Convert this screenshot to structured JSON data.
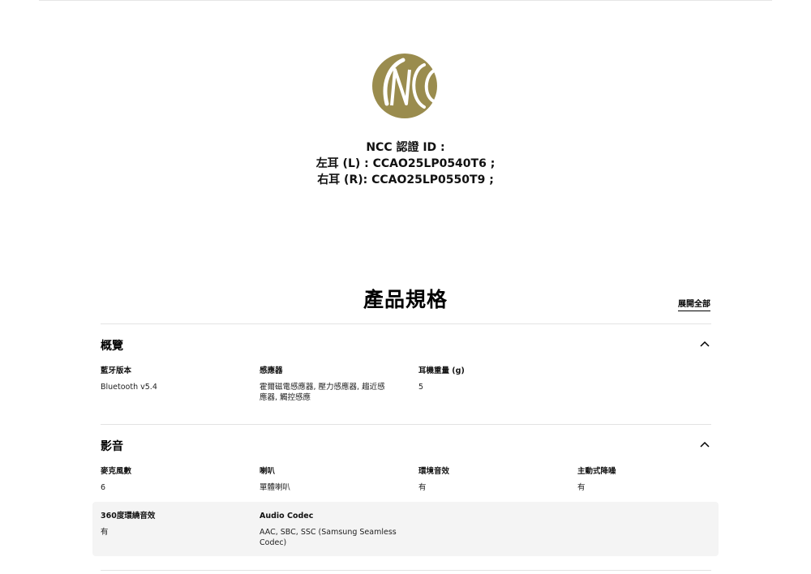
{
  "ncc": {
    "line1": "NCC 認證 ID :",
    "line2": "左耳 (L) : CCAO25LP0540T6 ;",
    "line3": "右耳 (R): CCAO25LP0550T9 ;"
  },
  "specs": {
    "title": "產品規格",
    "expand_all": "展開全部",
    "sections": [
      {
        "title": "概覽",
        "items": [
          {
            "label": "藍牙版本",
            "value": "Bluetooth v5.4"
          },
          {
            "label": "感應器",
            "value": "霍爾磁電感應器, 壓力感應器, 趨近感應器, 觸控感應"
          },
          {
            "label": "耳機重量 (g)",
            "value": "5"
          }
        ]
      },
      {
        "title": "影音",
        "items": [
          {
            "label": "麥克風數",
            "value": "6"
          },
          {
            "label": "喇叭",
            "value": "單體喇叭"
          },
          {
            "label": "環境音效",
            "value": "有"
          },
          {
            "label": "主動式降噪",
            "value": "有"
          },
          {
            "label": "360度環繞音效",
            "value": "有"
          },
          {
            "label": "Audio Codec",
            "value": "AAC, SBC, SSC (Samsung Seamless Codec)"
          }
        ]
      }
    ]
  },
  "colors": {
    "logo_gold": "#9a8c4e",
    "divider": "#e3e3e3",
    "highlight_bg": "#f4f4f4"
  }
}
